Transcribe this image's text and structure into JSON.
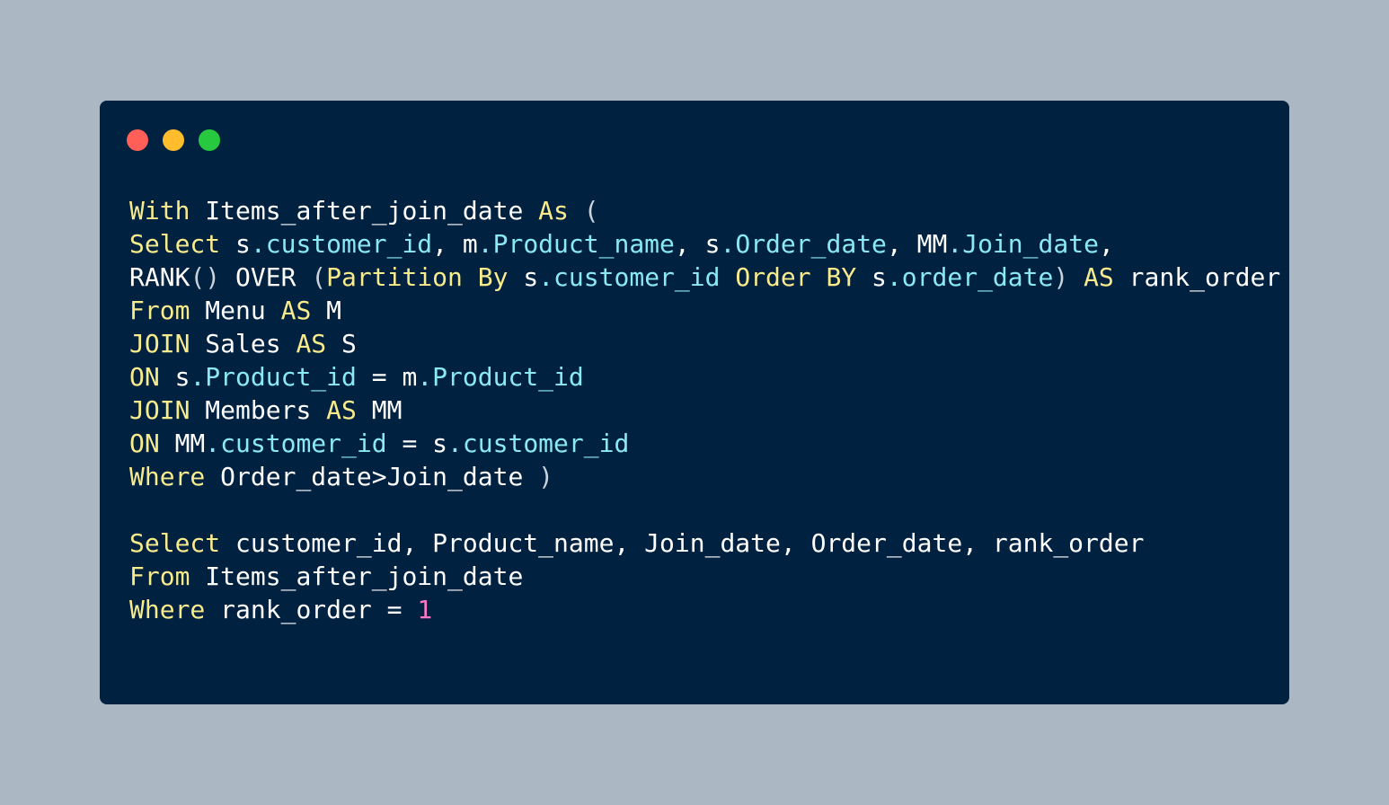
{
  "window": {
    "controls": [
      {
        "name": "close",
        "color": "#ff5f56"
      },
      {
        "name": "minimize",
        "color": "#ffbd2e"
      },
      {
        "name": "maximize",
        "color": "#27c93f"
      }
    ]
  },
  "colors": {
    "page_background": "#abb8c3",
    "editor_background": "#002140",
    "keyword": "#f8eb8c",
    "identifier": "#ffffff",
    "property": "#8be9f5",
    "punctuation": "#c9d3dc",
    "number": "#ff79c6"
  },
  "code": {
    "lines": [
      [
        [
          "kw",
          "With"
        ],
        [
          "id",
          " Items_after_join_date "
        ],
        [
          "kw",
          "As"
        ],
        [
          "punc",
          " ("
        ]
      ],
      [
        [
          "kw",
          "Select"
        ],
        [
          "id",
          " s"
        ],
        [
          "prop",
          ".customer_id"
        ],
        [
          "id",
          ", m"
        ],
        [
          "prop",
          ".Product_name"
        ],
        [
          "id",
          ", s"
        ],
        [
          "prop",
          ".Order_date"
        ],
        [
          "id",
          ", MM"
        ],
        [
          "prop",
          ".Join_date"
        ],
        [
          "id",
          ","
        ]
      ],
      [
        [
          "id",
          "RANK"
        ],
        [
          "punc",
          "()"
        ],
        [
          "id",
          " OVER "
        ],
        [
          "punc",
          "("
        ],
        [
          "kw",
          "Partition By"
        ],
        [
          "id",
          " s"
        ],
        [
          "prop",
          ".customer_id"
        ],
        [
          "id",
          " "
        ],
        [
          "kw",
          "Order BY"
        ],
        [
          "id",
          " s"
        ],
        [
          "prop",
          ".order_date"
        ],
        [
          "punc",
          ")"
        ],
        [
          "id",
          " "
        ],
        [
          "kw",
          "AS"
        ],
        [
          "id",
          " rank_order"
        ]
      ],
      [
        [
          "kw",
          "From"
        ],
        [
          "id",
          " Menu "
        ],
        [
          "kw",
          "AS"
        ],
        [
          "id",
          " M"
        ]
      ],
      [
        [
          "kw",
          "JOIN"
        ],
        [
          "id",
          " Sales "
        ],
        [
          "kw",
          "AS"
        ],
        [
          "id",
          " S"
        ]
      ],
      [
        [
          "kw",
          "ON"
        ],
        [
          "id",
          " s"
        ],
        [
          "prop",
          ".Product_id"
        ],
        [
          "id",
          " = m"
        ],
        [
          "prop",
          ".Product_id"
        ]
      ],
      [
        [
          "kw",
          "JOIN"
        ],
        [
          "id",
          " Members "
        ],
        [
          "kw",
          "AS"
        ],
        [
          "id",
          " MM"
        ]
      ],
      [
        [
          "kw",
          "ON"
        ],
        [
          "id",
          " MM"
        ],
        [
          "prop",
          ".customer_id"
        ],
        [
          "id",
          " = s"
        ],
        [
          "prop",
          ".customer_id"
        ]
      ],
      [
        [
          "kw",
          "Where"
        ],
        [
          "id",
          " Order_date>Join_date "
        ],
        [
          "punc",
          ")"
        ]
      ],
      [],
      [
        [
          "kw",
          "Select"
        ],
        [
          "id",
          " customer_id, Product_name, Join_date, Order_date, rank_order"
        ]
      ],
      [
        [
          "kw",
          "From"
        ],
        [
          "id",
          " Items_after_join_date"
        ]
      ],
      [
        [
          "kw",
          "Where"
        ],
        [
          "id",
          " rank_order = "
        ],
        [
          "num",
          "1"
        ]
      ]
    ]
  }
}
